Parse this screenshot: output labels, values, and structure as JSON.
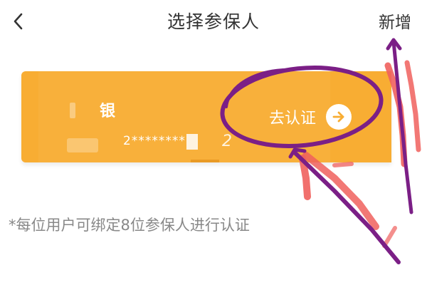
{
  "header": {
    "title": "选择参保人",
    "add_label": "新增"
  },
  "card": {
    "name": "银",
    "id_masked": "2********",
    "id_tail": "2",
    "verify_label": "去认证"
  },
  "hint": "*每位用户可绑定8位参保人进行认证",
  "colors": {
    "card_bg": "#f8ad33",
    "annotation_purple": "#7b1f86",
    "annotation_red": "#f0605d"
  }
}
